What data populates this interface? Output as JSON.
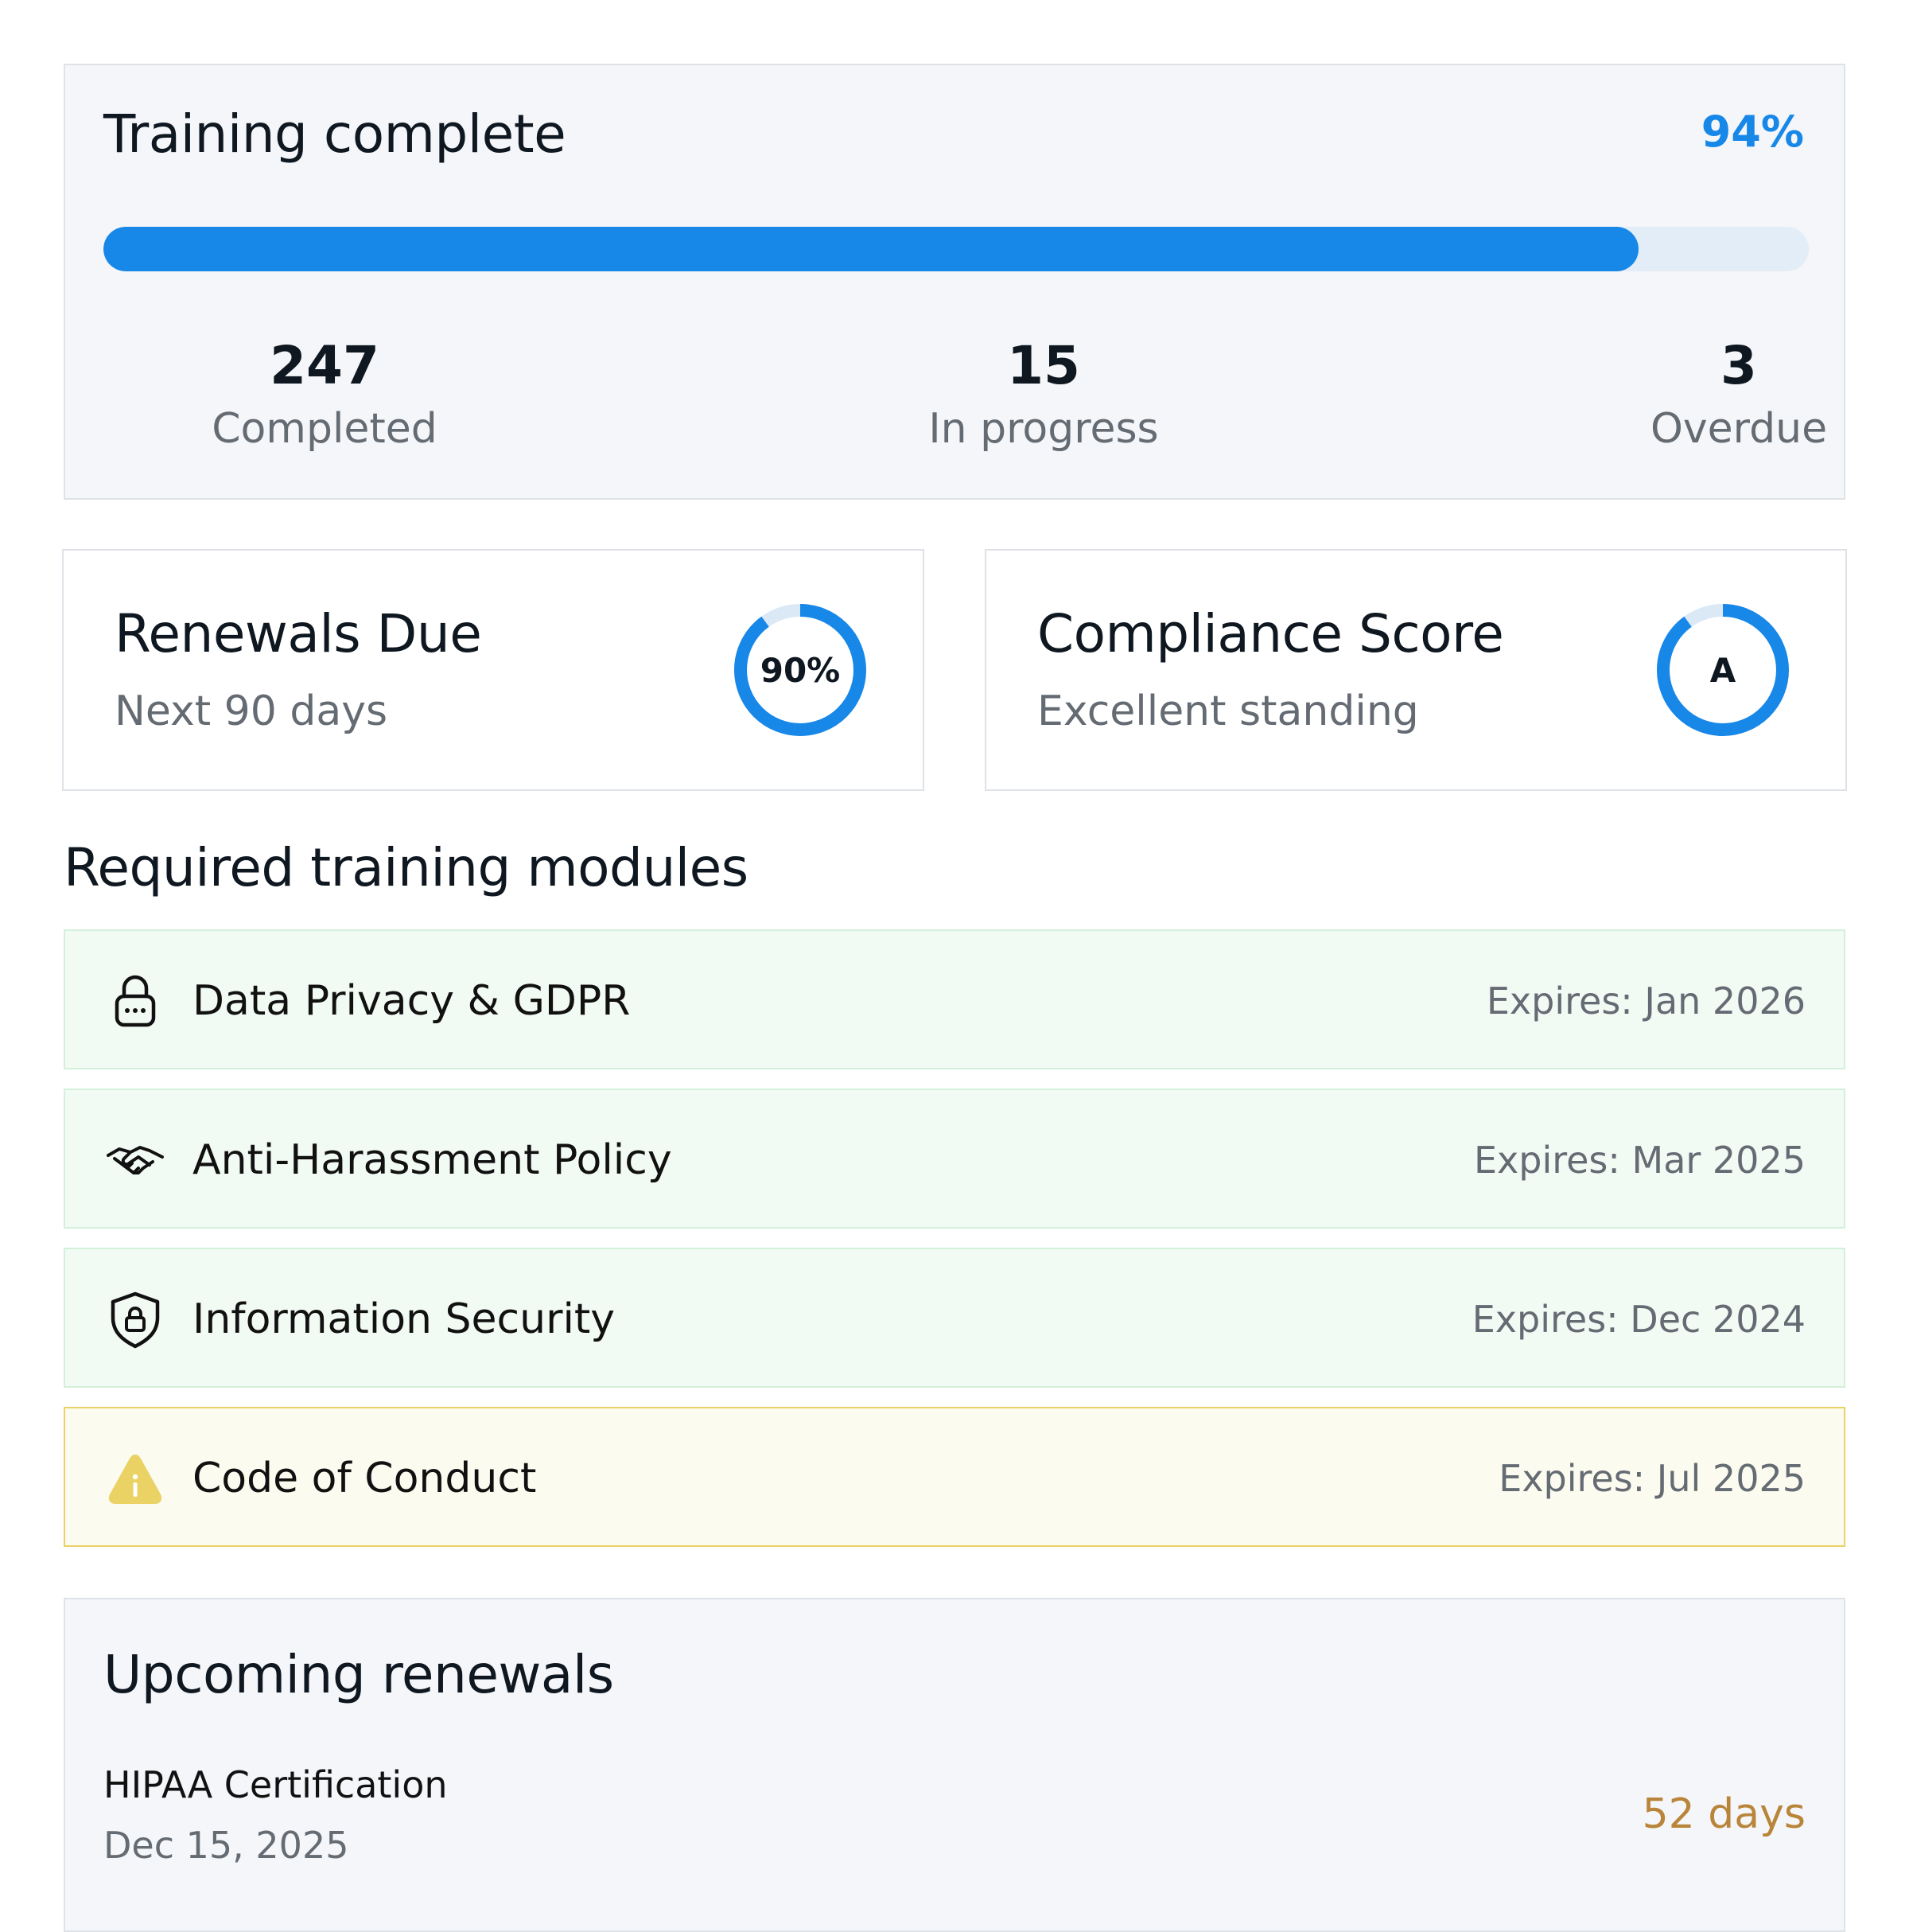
{
  "summary": {
    "title": "Training complete",
    "percent_label": "94%",
    "progress_fraction": 0.9,
    "stats": [
      {
        "value": "247",
        "label": "Completed"
      },
      {
        "value": "15",
        "label": "In progress"
      },
      {
        "value": "3",
        "label": "Overdue"
      }
    ]
  },
  "renewals_card": {
    "title": "Renewals Due",
    "subtitle": "Next 90 days",
    "ring_label": "90%",
    "ring_fraction": 0.9
  },
  "compliance_card": {
    "title": "Compliance Score",
    "subtitle": "Excellent standing",
    "ring_label": "A",
    "ring_fraction": 0.9
  },
  "modules": {
    "heading": "Required training modules",
    "items": [
      {
        "icon": "lock-icon",
        "name": "Data Privacy & GDPR",
        "expires": "Expires: Jan 2026",
        "status": "ok"
      },
      {
        "icon": "handshake-icon",
        "name": "Anti-Harassment Policy",
        "expires": "Expires: Mar 2025",
        "status": "ok"
      },
      {
        "icon": "shield-lock-icon",
        "name": "Information Security",
        "expires": "Expires: Dec 2024",
        "status": "ok"
      },
      {
        "icon": "warning-icon",
        "name": "Code of Conduct",
        "expires": "Expires: Jul 2025",
        "status": "warning"
      }
    ]
  },
  "upcoming": {
    "title": "Upcoming renewals",
    "items": [
      {
        "name": "HIPAA Certification",
        "date": "Dec 15, 2025",
        "days": "52 days"
      }
    ]
  },
  "colors": {
    "accent": "#1787e8",
    "track": "#e3edf7",
    "ok_bg": "#f2faf4",
    "warn_bg": "#fcfbef",
    "warn_border": "#ecd163",
    "days": "#b9853a"
  }
}
